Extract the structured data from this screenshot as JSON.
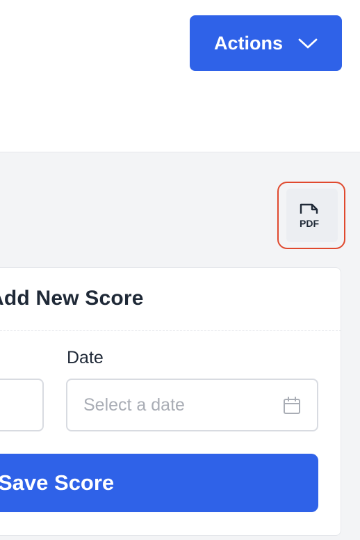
{
  "header": {
    "actions_label": "Actions",
    "actions_icon": "chevron-down-icon"
  },
  "toolbar": {
    "pdf_icon": "pdf-file-icon",
    "pdf_icon_text": "PDF"
  },
  "score_form": {
    "title": "Add New Score",
    "date_label": "Date",
    "date_placeholder": "Select a date",
    "date_icon": "calendar-icon",
    "submit_label": "Save Score"
  },
  "colors": {
    "primary": "#2f62e8",
    "focus_outline": "#e0492e",
    "background": "#f3f4f6"
  }
}
